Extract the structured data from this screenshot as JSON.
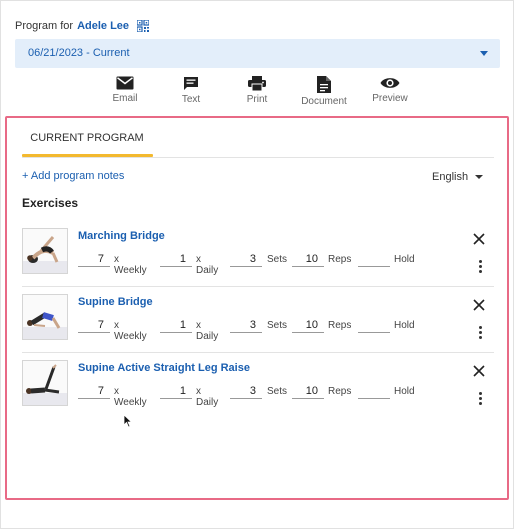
{
  "header": {
    "prefix": "Program for",
    "patient_name": "Adele Lee",
    "qr_icon": "qr-code-icon"
  },
  "program_select": {
    "value": "06/21/2023 - Current"
  },
  "actions": [
    {
      "label": "Email",
      "icon": "email-icon"
    },
    {
      "label": "Text",
      "icon": "message-icon"
    },
    {
      "label": "Print",
      "icon": "printer-icon"
    },
    {
      "label": "Document",
      "icon": "document-icon"
    },
    {
      "label": "Preview",
      "icon": "eye-icon"
    }
  ],
  "tabs": {
    "current": "CURRENT PROGRAM"
  },
  "add_notes": "+ Add program notes",
  "language": "English",
  "exercises_heading": "Exercises",
  "labels": {
    "weekly": "x Weekly",
    "daily": "x Daily",
    "sets": "Sets",
    "reps": "Reps",
    "hold": "Hold"
  },
  "exercises": [
    {
      "name": "Marching Bridge",
      "weekly": "7",
      "daily": "1",
      "sets": "3",
      "reps": "10",
      "hold": ""
    },
    {
      "name": "Supine Bridge",
      "weekly": "7",
      "daily": "1",
      "sets": "3",
      "reps": "10",
      "hold": ""
    },
    {
      "name": "Supine Active Straight Leg Raise",
      "weekly": "7",
      "daily": "1",
      "sets": "3",
      "reps": "10",
      "hold": ""
    }
  ],
  "colors": {
    "accent": "#1b5fb0",
    "select_bg": "#e3eefa",
    "tab_underline": "#f3b92f",
    "highlight_border": "#e86a86"
  }
}
